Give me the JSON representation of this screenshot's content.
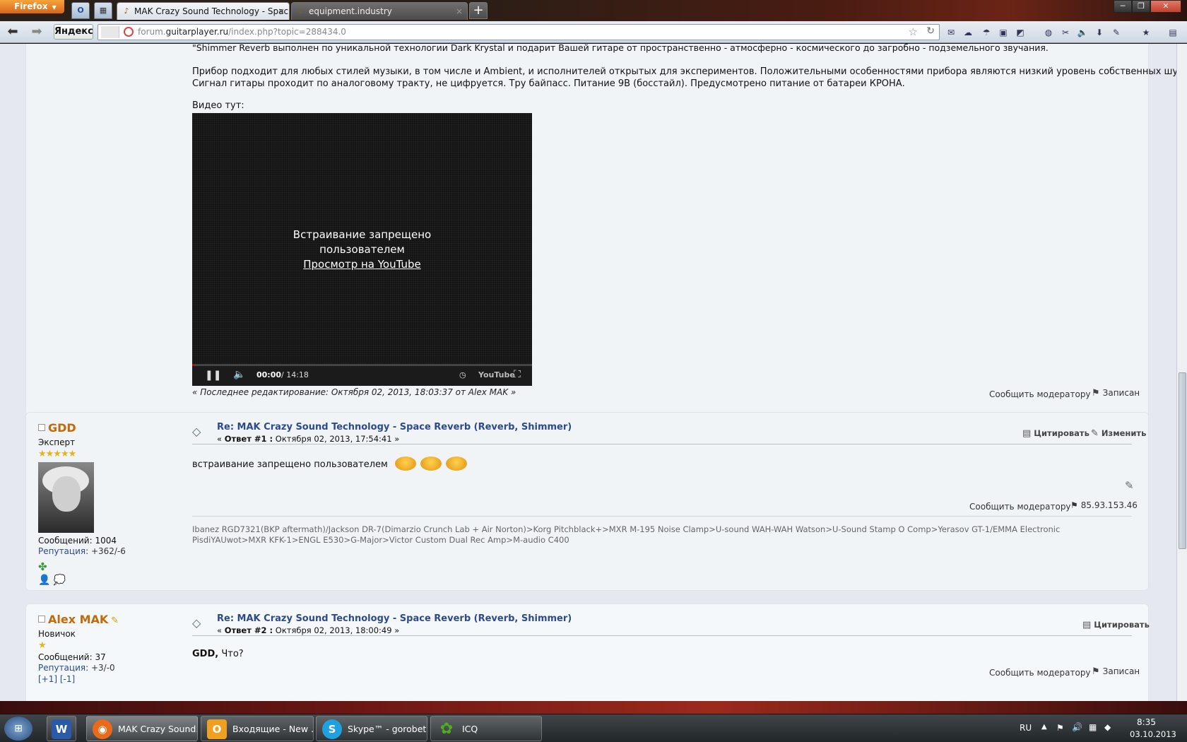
{
  "browser": {
    "firefox_label": "Firefox",
    "pinned": [
      {
        "icon": "outlook-icon",
        "label": "O"
      },
      {
        "icon": "app-icon",
        "label": "▦"
      }
    ],
    "tabs": [
      {
        "title": "MAK Crazy Sound Technology - Spac...",
        "active": true
      },
      {
        "title": "equipment.industry",
        "active": false
      }
    ],
    "new_tab": "+",
    "yandex_label": "Яндекс",
    "url": {
      "prefix": "forum.",
      "domain": "guitarplayer.ru",
      "path": "/index.php?topic=288434.0"
    }
  },
  "post0": {
    "cut_line": "\"Shimmer Reverb выполнен по уникальной технологии Dark Krystal и подарит Вашей гитаре от       пространственно - атмосферно - космического до загробно - подземельного звучания.",
    "para1": "Прибор подходит для любых стилей музыки, в том числе и Ambient, и исполнителей открытых для экспериментов. Положительными особенностями прибора являются низкий уровень собственных шумов.",
    "para2": "Сигнал гитары проходит по аналоговому тракту, не цифруется. Тру байпасс. Питание 9В (босстайл). Предусмотрено питание от батареи КРОНА.",
    "video_label": "Видео тут:",
    "video": {
      "msg1": "Встраивание запрещено",
      "msg2": "пользователем",
      "link": "Просмотр на YouTube",
      "time": "00:00",
      "duration": "/ 14:18",
      "logo": "YouTube"
    },
    "edit_note": "« Последнее редактирование: Октября 02, 2013, 18:03:37 от Alex MAK »",
    "report": "Сообщить модератору",
    "logged": "Записан"
  },
  "post1": {
    "author": "GDD",
    "rank": "Эксперт",
    "stars": "★★★★★",
    "posts": "Сообщений: 1004",
    "rep_label": "Репутация",
    "rep_value": ": +362/-6",
    "subject": "Re: MAK Crazy Sound Technology - Space Reverb (Reverb, Shimmer)",
    "reply_prefix": "« ",
    "reply_num": "Ответ #1 :",
    "reply_date": " Октября 02, 2013, 17:54:41 »",
    "quote": "Цитировать",
    "edit": "Изменить",
    "text": "встраивание запрещено пользователем",
    "report": "Сообщить модератору",
    "ip": "85.93.153.46",
    "signature": "Ibanez RGD7321(BKP aftermath)/Jackson DR-7(Dimarzio Crunch Lab + Air Norton)>Korg Pitchblack+>MXR M-195 Noise Clamp>U-sound WAH-WAH Watson>U-Sound Stamp O Comp>Yerasov GT-1/EMMA Electronic PisdiYAUwot>MXR KFK-1>ENGL E530>G-Major>Victor Custom Dual Rec Amp>M-audio C400"
  },
  "post2": {
    "author": "Alex MAK",
    "rank": "Новичок",
    "stars": "★",
    "posts": "Сообщений: 37",
    "rep_label": "Репутация",
    "rep_value": ": +3/-0",
    "rep_links": "[+1] [-1]",
    "subject": "Re: MAK Crazy Sound Technology - Space Reverb (Reverb, Shimmer)",
    "reply_prefix": "« ",
    "reply_num": "Ответ #2 :",
    "reply_date": " Октября 02, 2013, 18:00:49 »",
    "quote": "Цитировать",
    "text_bold": "GDD,",
    "text": " Что?",
    "report": "Сообщить модератору",
    "logged": "Записан"
  },
  "taskbar": {
    "tasks": [
      {
        "label": "",
        "icon": "W",
        "color": "#2a5aa8"
      },
      {
        "label": "MAK Crazy Sound...",
        "icon": "◉",
        "color": "#e86a1a",
        "active": true
      },
      {
        "label": "Входящие - New ...",
        "icon": "O",
        "color": "#f0a020"
      },
      {
        "label": "Skype™ - gorobet...",
        "icon": "S",
        "color": "#1fa0e0"
      },
      {
        "label": "ICQ",
        "icon": "✿",
        "color": "#4caf1c"
      }
    ],
    "lang": "RU",
    "time": "8:35",
    "date": "03.10.2013"
  }
}
